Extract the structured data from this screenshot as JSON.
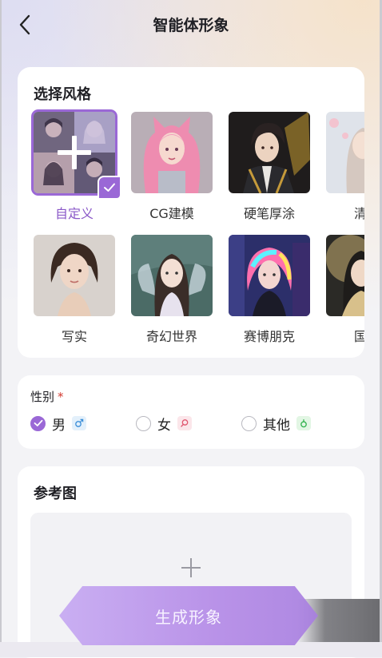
{
  "header": {
    "title": "智能体形象"
  },
  "style_section": {
    "title": "选择风格",
    "items": [
      {
        "label": "自定义",
        "selected": true
      },
      {
        "label": "CG建模"
      },
      {
        "label": "硬笔厚涂"
      },
      {
        "label": "清新"
      },
      {
        "label": "写实"
      },
      {
        "label": "奇幻世界"
      },
      {
        "label": "赛博朋克"
      },
      {
        "label": "国风"
      }
    ]
  },
  "gender": {
    "label": "性别",
    "required_mark": "*",
    "options": [
      {
        "label": "男",
        "icon": "male-icon",
        "checked": true
      },
      {
        "label": "女",
        "icon": "female-icon"
      },
      {
        "label": "其他",
        "icon": "other-gender-icon"
      }
    ]
  },
  "reference": {
    "title": "参考图"
  },
  "generate": {
    "label": "生成形象"
  },
  "colors": {
    "accent": "#9a68d6"
  }
}
